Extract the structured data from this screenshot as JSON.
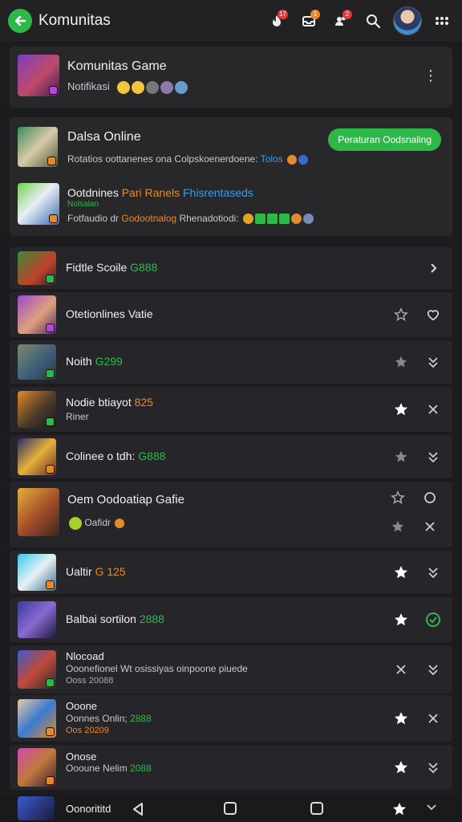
{
  "header": {
    "title": "Komunitas",
    "badge_a": "17",
    "badge_b": "1",
    "badge_c": "2"
  },
  "card1": {
    "title": "Komunitas Game",
    "meta": "Notifikasi"
  },
  "card2": {
    "title": "Dalsa Online",
    "button": "Peraturan Oodsnaling",
    "line1_prefix": "Rotatios oottanenes ona Colpskoenerdoene:",
    "line1_tag": "Tolos",
    "sub_title": "Ootdnines",
    "sub_title_mid": "Pari Ranels",
    "sub_title_blue": "Fhisrentaseds",
    "sub_tag": "Nolsalan",
    "sub_line_prefix": "Fotfaudio dr",
    "sub_line_orange": "Godootnalog",
    "sub_line_suffix": "Rhenadotiodi:"
  },
  "rows": [
    {
      "title": "Fidtle Scoile",
      "value": "G888"
    },
    {
      "title": "Otetionlines Vatie",
      "value": ""
    },
    {
      "title": "Noith",
      "value": "G299"
    },
    {
      "title": "Nodie btiayot",
      "value": "825",
      "sub": "Riner"
    },
    {
      "title": "Colinee o tdh:",
      "value": "G888"
    },
    {
      "title": "Oem Oodoatiap Gafie",
      "value": "",
      "sub": "Oafidr"
    },
    {
      "title": "Ualtir",
      "value": "G 125"
    },
    {
      "title": "Balbai sortilon",
      "value": "2888"
    },
    {
      "title": "Nlocoad",
      "sub": "Ooonefionel Wt osissiyas oinpoone piuede",
      "sub2": "Ooss 20088"
    },
    {
      "title": "Ooone",
      "sub": "Oonnes Onlin;",
      "value": "2888",
      "sub2": "Oos 20209"
    },
    {
      "title": "Onose",
      "sub": "Oooune Nelim",
      "value": "2088"
    },
    {
      "title": "Oonorititd"
    }
  ],
  "colors": {
    "accent": "#2fb84a",
    "bg": "#1c1c1e",
    "card": "#28282b",
    "orange": "#e58a2a",
    "blue": "#3a9be8"
  }
}
